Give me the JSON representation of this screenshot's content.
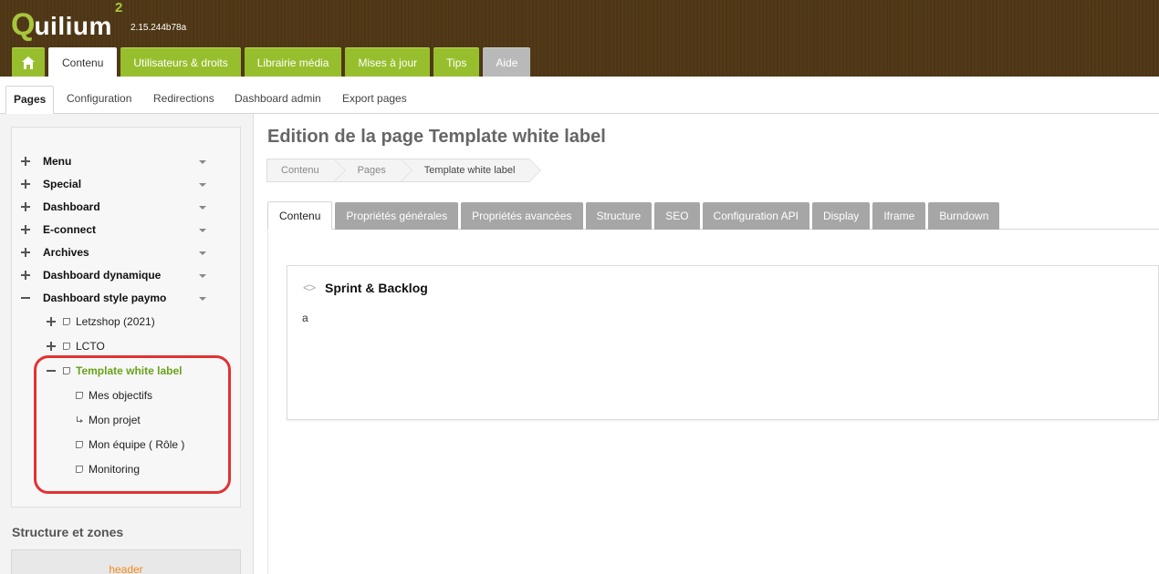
{
  "app": {
    "logo_q": "Q",
    "logo_rest": "uilium",
    "logo_superscript": "2",
    "version": "2.15.244b78a"
  },
  "main_tabs": [
    {
      "label": "Contenu"
    },
    {
      "label": "Utilisateurs & droits"
    },
    {
      "label": "Librairie média"
    },
    {
      "label": "Mises à jour"
    },
    {
      "label": "Tips"
    },
    {
      "label": "Aide"
    }
  ],
  "sub_tabs": [
    {
      "label": "Pages"
    },
    {
      "label": "Configuration"
    },
    {
      "label": "Redirections"
    },
    {
      "label": "Dashboard admin"
    },
    {
      "label": "Export pages"
    }
  ],
  "tree": {
    "items": [
      {
        "label": "Menu"
      },
      {
        "label": "Special"
      },
      {
        "label": "Dashboard"
      },
      {
        "label": "E-connect"
      },
      {
        "label": "Archives"
      },
      {
        "label": "Dashboard dynamique"
      },
      {
        "label": "Dashboard style paymo"
      }
    ],
    "children": [
      {
        "label": "Letzshop (2021)"
      },
      {
        "label": "LCTO"
      },
      {
        "label": "Template white label"
      }
    ],
    "grandchildren": [
      {
        "label": "Mes objectifs"
      },
      {
        "label": "Mon projet"
      },
      {
        "label": "Mon équipe ( Rôle )"
      },
      {
        "label": "Monitoring"
      }
    ]
  },
  "structure": {
    "title": "Structure et zones",
    "zone_label": "header"
  },
  "page": {
    "title": "Edition de la page Template white label",
    "breadcrumb": [
      "Contenu",
      "Pages",
      "Template white label"
    ]
  },
  "content_tabs": [
    {
      "label": "Contenu"
    },
    {
      "label": "Propriétés générales"
    },
    {
      "label": "Propriétés avancées"
    },
    {
      "label": "Structure"
    },
    {
      "label": "SEO"
    },
    {
      "label": "Configuration API"
    },
    {
      "label": "Display"
    },
    {
      "label": "Iframe"
    },
    {
      "label": "Burndown"
    }
  ],
  "block": {
    "title": "Sprint & Backlog",
    "text": "a"
  },
  "colors": {
    "brand_green": "#97bf2d",
    "header_brown": "#4a3415",
    "selected_text": "#69a21b",
    "highlight_red": "#e23232"
  }
}
